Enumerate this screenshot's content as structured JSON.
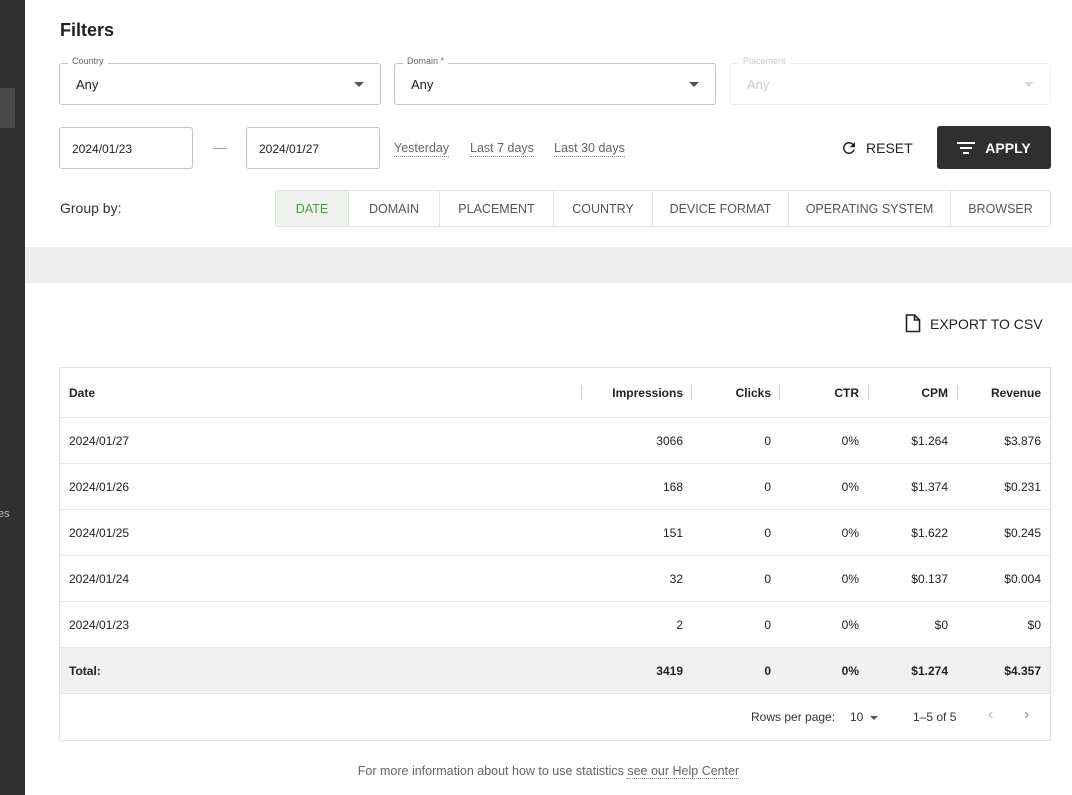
{
  "filters": {
    "title": "Filters",
    "country": {
      "label": "Country",
      "value": "Any"
    },
    "domain": {
      "label": "Domain *",
      "value": "Any"
    },
    "placement": {
      "label": "Placement",
      "value": "Any"
    },
    "date_from": "2024/01/23",
    "date_to": "2024/01/27",
    "quick_ranges": [
      "Yesterday",
      "Last 7 days",
      "Last 30 days"
    ],
    "reset_label": "RESET",
    "apply_label": "APPLY"
  },
  "group_by": {
    "label": "Group by:",
    "options": [
      "DATE",
      "DOMAIN",
      "PLACEMENT",
      "COUNTRY",
      "DEVICE FORMAT",
      "OPERATING SYSTEM",
      "BROWSER"
    ],
    "selected": "DATE"
  },
  "export_label": "EXPORT TO CSV",
  "table": {
    "columns": [
      "Date",
      "Impressions",
      "Clicks",
      "CTR",
      "CPM",
      "Revenue"
    ],
    "rows": [
      [
        "2024/01/27",
        "3066",
        "0",
        "0%",
        "$1.264",
        "$3.876"
      ],
      [
        "2024/01/26",
        "168",
        "0",
        "0%",
        "$1.374",
        "$0.231"
      ],
      [
        "2024/01/25",
        "151",
        "0",
        "0%",
        "$1.622",
        "$0.245"
      ],
      [
        "2024/01/24",
        "32",
        "0",
        "0%",
        "$0.137",
        "$0.004"
      ],
      [
        "2024/01/23",
        "2",
        "0",
        "0%",
        "$0",
        "$0"
      ]
    ],
    "total": [
      "Total:",
      "3419",
      "0",
      "0%",
      "$1.274",
      "$4.357"
    ]
  },
  "pagination": {
    "rows_per_page_label": "Rows per page:",
    "rows_per_page": "10",
    "range": "1–5 of 5"
  },
  "footer": {
    "text": "For more information about how to use statistics",
    "link": "see our Help Center"
  },
  "sidebar": {
    "partial_text": "es"
  },
  "colors": {
    "accent_green": "#4a9b4a",
    "apply_bg": "#2f2f2f",
    "sidebar_bg": "#303030"
  }
}
